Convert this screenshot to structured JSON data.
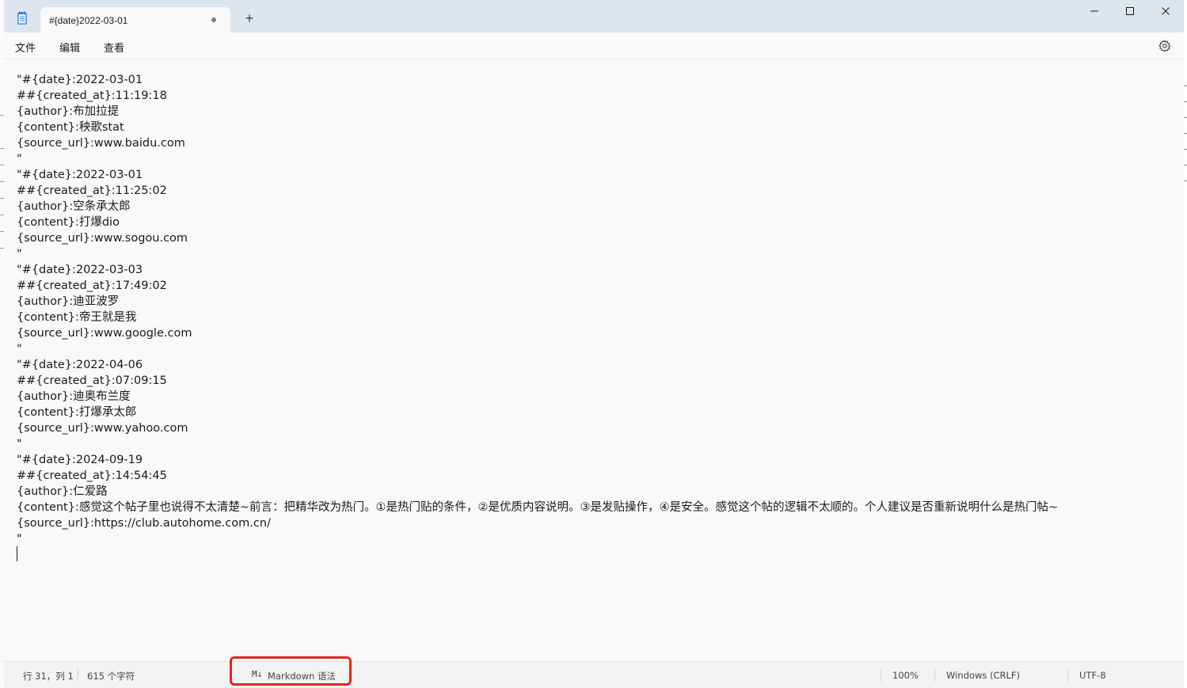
{
  "window": {
    "tab_title": "#{date}2022-03-01",
    "new_tab_glyph": "+",
    "app_icon": "notepad-icon",
    "minimize_icon": "minimize-icon",
    "maximize_icon": "maximize-icon",
    "close_icon": "close-icon"
  },
  "menu": {
    "file": "文件",
    "edit": "编辑",
    "view": "查看",
    "settings_icon": "gear-icon"
  },
  "editor": {
    "lines": [
      "\"#{date}:2022-03-01",
      "##{created_at}:11:19:18",
      "{author}:布加拉提",
      "{content}:秧歌stat",
      "{source_url}:www.baidu.com",
      "\"",
      "\"#{date}:2022-03-01",
      "##{created_at}:11:25:02",
      "{author}:空条承太郎",
      "{content}:打爆dio",
      "{source_url}:www.sogou.com",
      "\"",
      "\"#{date}:2022-03-03",
      "##{created_at}:17:49:02",
      "{author}:迪亚波罗",
      "{content}:帝王就是我",
      "{source_url}:www.google.com",
      "\"",
      "\"#{date}:2022-04-06",
      "##{created_at}:07:09:15",
      "{author}:迪奥布兰度",
      "{content}:打爆承太郎",
      "{source_url}:www.yahoo.com",
      "\"",
      "\"#{date}:2024-09-19",
      "##{created_at}:14:54:45",
      "{author}:仁爱路",
      "{content}:感觉这个帖子里也说得不太清楚~前言：把精华改为热门。①是热门贴的条件，②是优质内容说明。③是发贴操作，④是安全。感觉这个帖的逻辑不太顺的。个人建议是否重新说明什么是热门帖~",
      "{source_url}:https://club.autohome.com.cn/",
      "\""
    ]
  },
  "status": {
    "position": "行 31，列 1",
    "char_count": "615 个字符",
    "markdown_icon": "M↓",
    "markdown": "Markdown 语法",
    "zoom": "100%",
    "line_ending": "Windows (CRLF)",
    "encoding": "UTF-8",
    "highlight_color": "#e0281e"
  }
}
